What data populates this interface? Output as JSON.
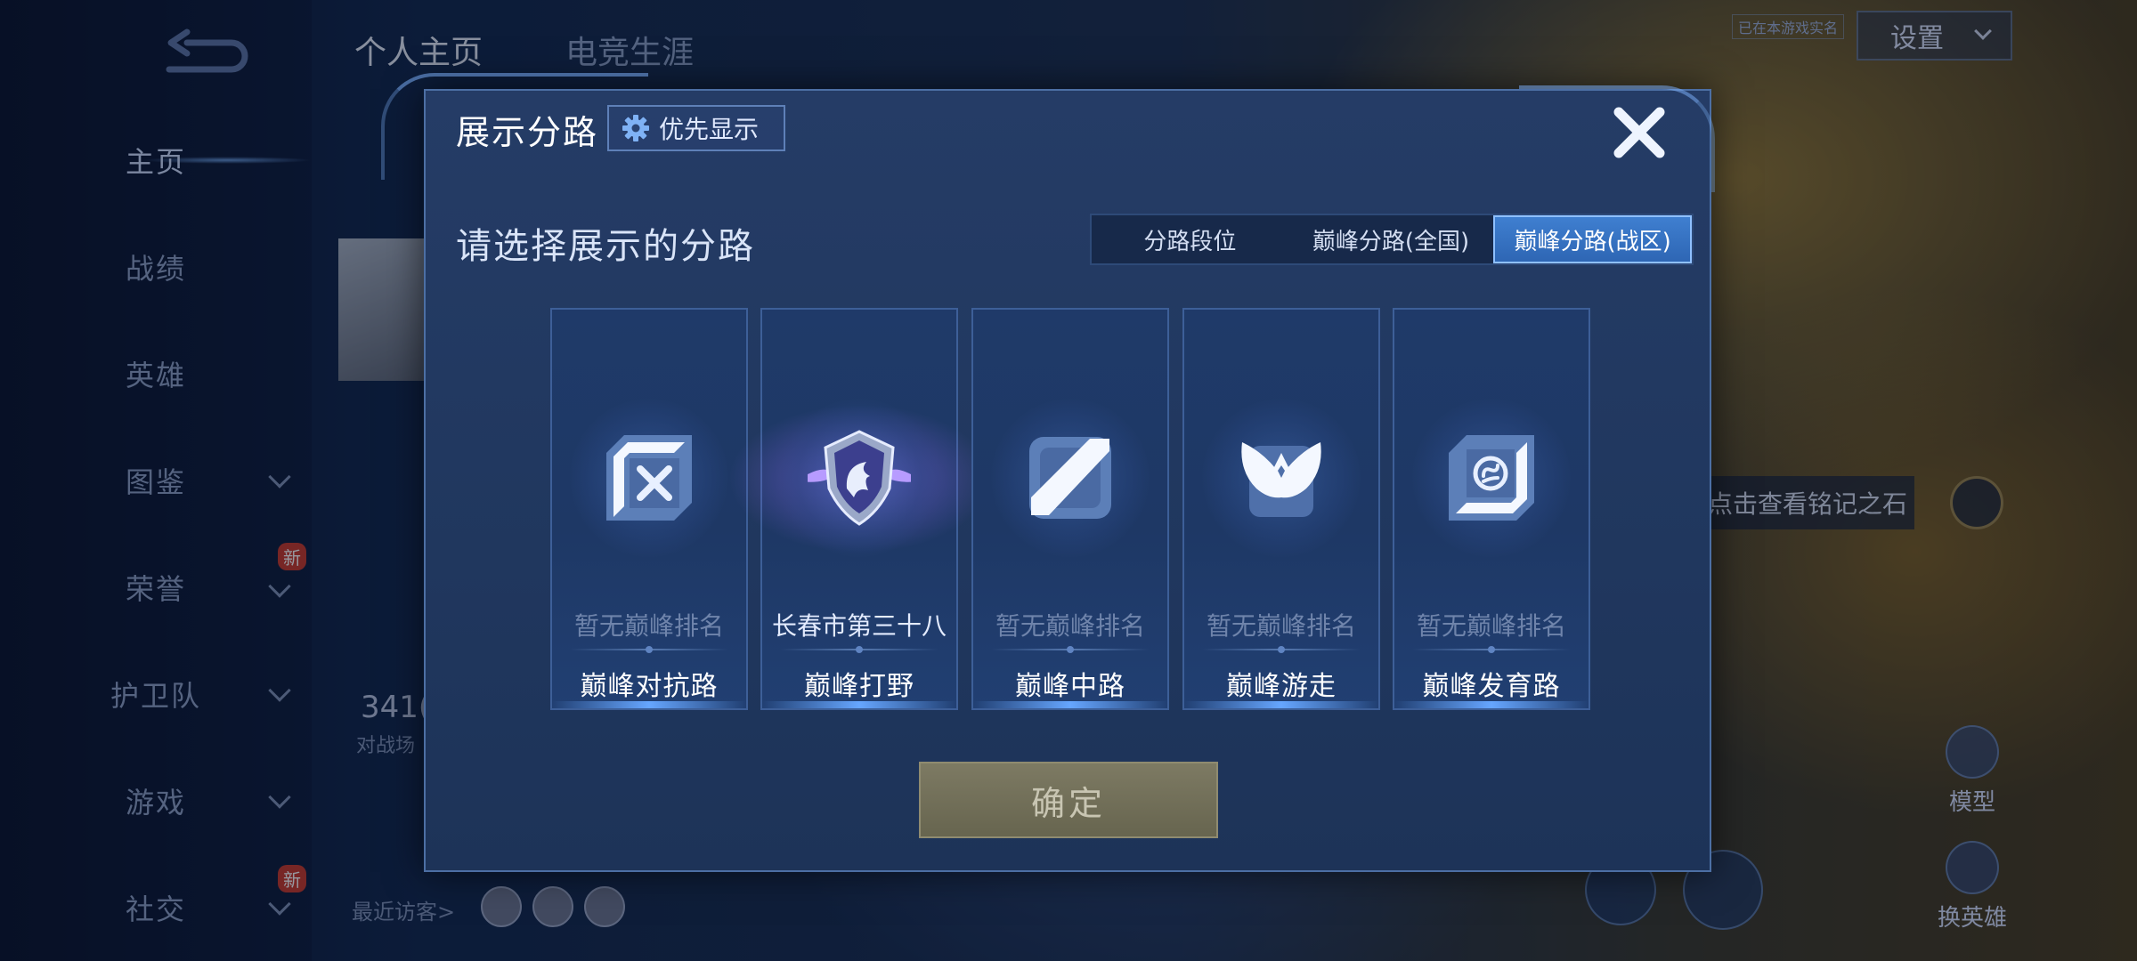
{
  "sidebar": {
    "items": [
      {
        "label": "主页",
        "active": true
      },
      {
        "label": "战绩"
      },
      {
        "label": "英雄"
      },
      {
        "label": "图鉴",
        "chevron": true
      },
      {
        "label": "荣誉",
        "chevron": true,
        "badge": "新"
      },
      {
        "label": "护卫队",
        "chevron": true
      },
      {
        "label": "游戏",
        "chevron": true
      },
      {
        "label": "社交",
        "chevron": true,
        "badge": "新"
      }
    ]
  },
  "topbar": {
    "tabs": [
      "个人主页",
      "电竞生涯"
    ],
    "settings_label": "设置",
    "small_tag": "已在本游戏实名"
  },
  "background": {
    "mingji_label": "点击查看铭记之石",
    "model_label": "模型",
    "change_hero_label": "换英雄",
    "visitors_label": "最近访客>",
    "stat_number": "341(",
    "stat_sub": "对战场"
  },
  "modal": {
    "title": "展示分路",
    "priority_button": "优先显示",
    "subtitle": "请选择展示的分路",
    "tabs": [
      {
        "label": "分路段位"
      },
      {
        "label": "巅峰分路(全国)"
      },
      {
        "label": "巅峰分路(战区)",
        "selected": true
      }
    ],
    "lanes": [
      {
        "name": "巅峰对抗路",
        "rank": "暂无巅峰排名",
        "icon": "clash-lane-icon"
      },
      {
        "name": "巅峰打野",
        "rank": "长春市第三十八",
        "icon": "jungle-emblem-icon",
        "ranked": true
      },
      {
        "name": "巅峰中路",
        "rank": "暂无巅峰排名",
        "icon": "mid-lane-icon"
      },
      {
        "name": "巅峰游走",
        "rank": "暂无巅峰排名",
        "icon": "roam-icon"
      },
      {
        "name": "巅峰发育路",
        "rank": "暂无巅峰排名",
        "icon": "farm-lane-icon"
      }
    ],
    "confirm_label": "确定"
  },
  "colors": {
    "accent": "#3f7fd0",
    "modal_bg": "#253c66",
    "confirm_disabled": "#7d7a63"
  }
}
